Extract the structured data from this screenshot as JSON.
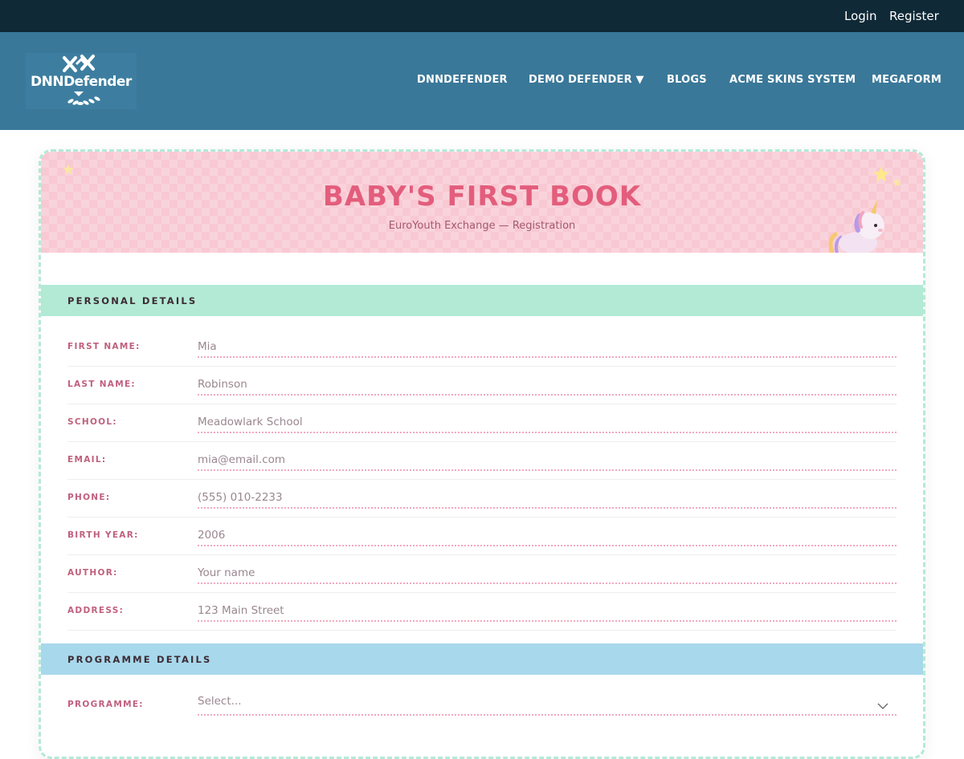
{
  "topbar": {
    "login": "Login",
    "register": "Register"
  },
  "header": {
    "logo_text": "DNNDefender",
    "nav": [
      "DNNDEFENDER",
      "DEMO DEFENDER ▼",
      "BLOGS",
      "ACME SKINS SYSTEM",
      "MEGAFORM"
    ]
  },
  "hero": {
    "title": "BABY'S FIRST BOOK",
    "subtitle": "EuroYouth Exchange — Registration"
  },
  "sections": {
    "personal": "PERSONAL DETAILS",
    "programme": "PROGRAMME DETAILS"
  },
  "fields": {
    "first_name": {
      "label": "FIRST NAME:",
      "value": "Mia"
    },
    "last_name": {
      "label": "LAST NAME:",
      "value": "Robinson"
    },
    "school": {
      "label": "SCHOOL:",
      "value": "Meadowlark School"
    },
    "email": {
      "label": "EMAIL:",
      "value": "mia@email.com"
    },
    "phone": {
      "label": "PHONE:",
      "value": "(555) 010-2233"
    },
    "birth_year": {
      "label": "BIRTH YEAR:",
      "value": "2006"
    },
    "author": {
      "label": "AUTHOR:",
      "placeholder": "Your name"
    },
    "address": {
      "label": "ADDRESS:",
      "value": "123 Main Street"
    },
    "programme": {
      "label": "PROGRAMME:",
      "selected": "Select..."
    }
  },
  "icons": {
    "logo": "shield-swords-logo",
    "stars": "star-icon",
    "mascot": "unicorn-icon",
    "select": "chevron-down-icon"
  },
  "colors": {
    "topbar": "#0f2937",
    "header": "#3a7899",
    "accent_pink": "#e35d7c",
    "mint": "#b3ead6",
    "sky": "#a8d8ec"
  }
}
